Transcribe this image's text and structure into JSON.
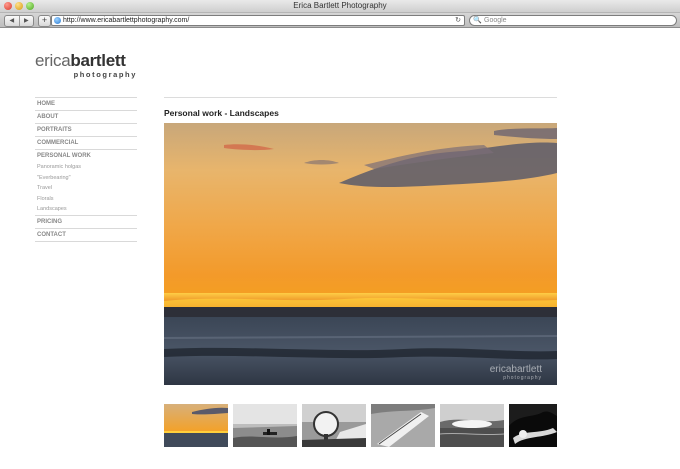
{
  "browser": {
    "window_title": "Erica Bartlett Photography",
    "nav_back": "◀",
    "nav_forward": "▶",
    "new_tab": "+",
    "url": "http://www.ericabartlettphotography.com/",
    "reload_icon": "↻",
    "search_placeholder": "Google",
    "search_icon": "🔍"
  },
  "logo": {
    "first": "erica",
    "last": "bartlett",
    "tagline": "photography"
  },
  "nav": {
    "items": [
      {
        "label": "HOME"
      },
      {
        "label": "ABOUT"
      },
      {
        "label": "PORTRAITS"
      },
      {
        "label": "COMMERCIAL"
      },
      {
        "label": "PERSONAL WORK"
      }
    ],
    "subitems": [
      {
        "label": "Panoramic holgas"
      },
      {
        "label": "\"Everbearing\""
      },
      {
        "label": "Travel"
      },
      {
        "label": "Florals"
      },
      {
        "label": "Landscapes"
      }
    ],
    "items_after": [
      {
        "label": "PRICING"
      },
      {
        "label": "CONTACT"
      }
    ]
  },
  "page": {
    "heading": "Personal work - Landscapes",
    "watermark": "ericabartlett",
    "watermark_tag": "photography"
  },
  "thumbnails": [
    {
      "name": "sunset-seascape"
    },
    {
      "name": "bw-jetty"
    },
    {
      "name": "bw-radar-dish"
    },
    {
      "name": "bw-sail-hull"
    },
    {
      "name": "bw-clouds-sea"
    },
    {
      "name": "bw-hill-silhouette"
    }
  ]
}
